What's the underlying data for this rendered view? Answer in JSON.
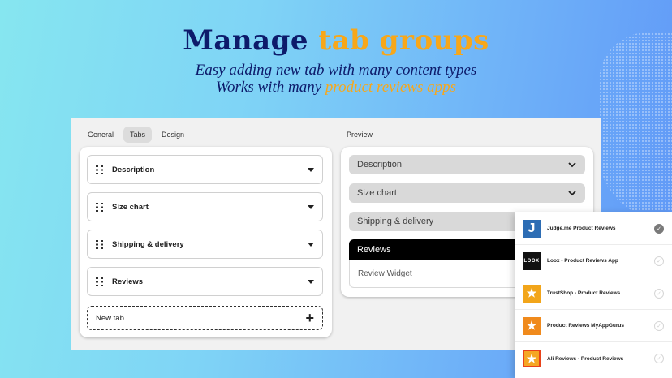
{
  "hero": {
    "title_part1": "Manage ",
    "title_accent": "tab groups",
    "subtitle1": "Easy adding new tab with many content types",
    "subtitle2_part1": "Works with many ",
    "subtitle2_accent": "product reviews apps"
  },
  "editor": {
    "tabs": [
      "General",
      "Tabs",
      "Design"
    ],
    "active_tab": "Tabs",
    "rows": [
      "Description",
      "Size chart",
      "Shipping & delivery",
      "Reviews"
    ],
    "new_tab_label": "New tab",
    "new_tab_icon": "plus-icon"
  },
  "preview": {
    "label": "Preview",
    "accordions": [
      "Description",
      "Size chart",
      "Shipping & delivery"
    ],
    "open_accordion": "Reviews",
    "open_content": "Review Widget"
  },
  "apps": [
    {
      "name": "Judge.me Product Reviews",
      "logo_text": "J",
      "logo_color": "#2d6db4",
      "selected": true
    },
    {
      "name": "Loox - Product Reviews App",
      "logo_text": "LOOX",
      "logo_color": "#111111",
      "selected": false
    },
    {
      "name": "TrustShop - Product Reviews",
      "logo_text": "★",
      "logo_color": "#f2a51a",
      "selected": false
    },
    {
      "name": "Product Reviews MyAppGurus",
      "logo_text": "★",
      "logo_color": "#f08a1c",
      "selected": false
    },
    {
      "name": "Ali Reviews - Product Reviews",
      "logo_text": "★",
      "logo_color": "#f5a623",
      "selected": false
    }
  ],
  "colors": {
    "title": "#0d1b6b",
    "accent": "#f7a71a"
  }
}
